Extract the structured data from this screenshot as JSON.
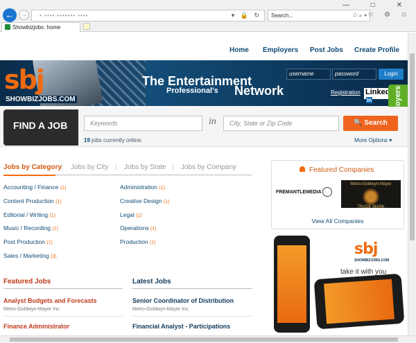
{
  "browser": {
    "address_text": "• •••• ••••••• ••••",
    "address_icons": "▾ 🔒 ↻",
    "search_placeholder": "Search...",
    "search_icons": "⌕ ▾",
    "tab_title": "Showbizjobs: home",
    "window_buttons": "— □ ✕",
    "tool_icons": "⌂ ☆ ⚙ ☺"
  },
  "site": {
    "nav": [
      "Home",
      "Employers",
      "Post Jobs",
      "Create Profile"
    ],
    "logo": "sbj",
    "logo_url": "SHOWBIZJOBS.COM",
    "tagline_1": "The Entertainment",
    "tagline_2": "Professional's",
    "tagline_3": "Network",
    "login": {
      "username_placeholder": "username",
      "password_placeholder": "password",
      "button": "Login"
    },
    "registration": "Registration",
    "linkedin": "Linked",
    "linkedin_in": "in",
    "employers_tab": "Employers"
  },
  "search": {
    "find_label": "FIND A JOB",
    "keywords_placeholder": "Keywords",
    "in_label": "in",
    "location_placeholder": "City, State or Zip Code",
    "button": "🔍 Search",
    "jobs_count": "19",
    "jobs_suffix": " jobs currently online.",
    "more_options": "More Options ▾"
  },
  "category_tabs": {
    "active": "Jobs by Category",
    "city": "Jobs by City",
    "state": "Jobs by State",
    "company": "Jobs by Company",
    "separator": "|"
  },
  "categories": [
    {
      "label": "Accounting / Finance",
      "count": "(1)"
    },
    {
      "label": "Administration",
      "count": "(1)"
    },
    {
      "label": "Content Production",
      "count": "(1)"
    },
    {
      "label": "Creative Design",
      "count": "(1)"
    },
    {
      "label": "Editorial / Writing",
      "count": "(1)"
    },
    {
      "label": "Legal",
      "count": "(1)"
    },
    {
      "label": "Music / Recording",
      "count": "(1)"
    },
    {
      "label": "Operations",
      "count": "(1)"
    },
    {
      "label": "Post Production",
      "count": "(1)"
    },
    {
      "label": "Production",
      "count": "(1)"
    },
    {
      "label": "Sales / Marketing",
      "count": "(3)"
    }
  ],
  "featured_companies": {
    "title": "Featured Companies",
    "company_1": "FREMANTLEMEDIA",
    "company_2_top": "Metro-Goldwyn-Mayer",
    "company_2_bottom": "TRADE MARK",
    "view_all": "View All Companies"
  },
  "promo": {
    "logo": "sbj",
    "url": "SHOWBIZJOBS.COM",
    "tagline": "take it with you"
  },
  "featured_jobs": {
    "title": "Featured Jobs",
    "items": [
      {
        "title": "Analyst Budgets and Forecasts",
        "company": "Metro-Goldwyn-Mayer Inc."
      },
      {
        "title": "Finance Administrator",
        "company": ""
      }
    ]
  },
  "latest_jobs": {
    "title": "Latest Jobs",
    "items": [
      {
        "title": "Senior Coordinator of Distribution",
        "company": "Metro-Goldwyn-Mayer Inc."
      },
      {
        "title": "Financial Analyst - Participations",
        "company": ""
      }
    ]
  },
  "colors": {
    "brand_orange": "#f26b0f",
    "navy": "#0e4a75",
    "green": "#5fae26",
    "featured_red": "#c0391b"
  }
}
